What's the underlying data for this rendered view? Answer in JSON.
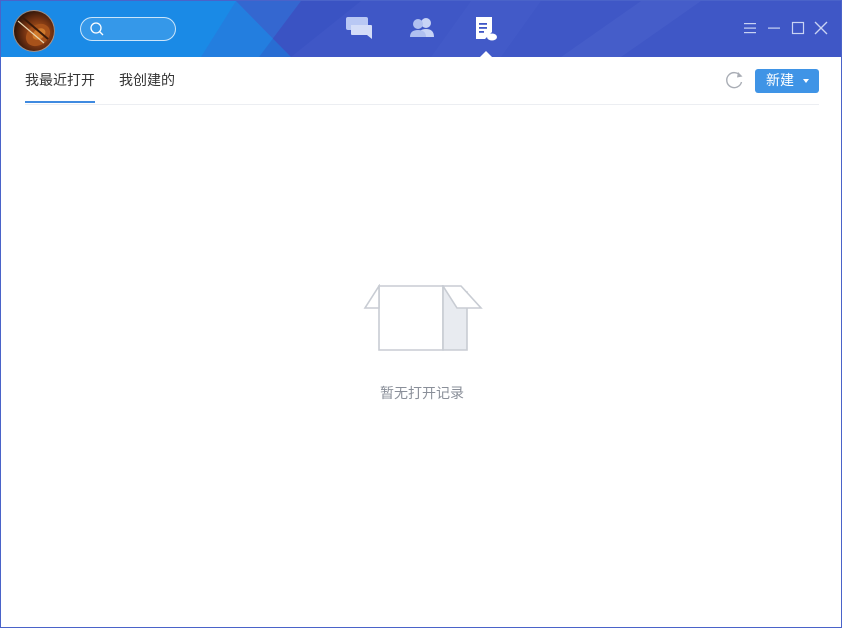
{
  "window": {
    "search": {
      "placeholder": "",
      "value": ""
    },
    "nav": [
      {
        "name": "messages-icon",
        "active": false
      },
      {
        "name": "contacts-icon",
        "active": false
      },
      {
        "name": "documents-icon",
        "active": true
      }
    ],
    "controls": [
      "menu-icon",
      "minimize-icon",
      "maximize-icon",
      "close-icon"
    ]
  },
  "tabs": {
    "recent_label": "我最近打开",
    "created_label": "我创建的",
    "active": "recent"
  },
  "toolbar": {
    "new_label": "新建"
  },
  "empty_state": {
    "message": "暂无打开记录"
  },
  "colors": {
    "titlebar": "#3f57c6",
    "titlebar_accent": "#1a8ae6",
    "button": "#3f94e6",
    "tab_underline": "#3f8ae0"
  }
}
